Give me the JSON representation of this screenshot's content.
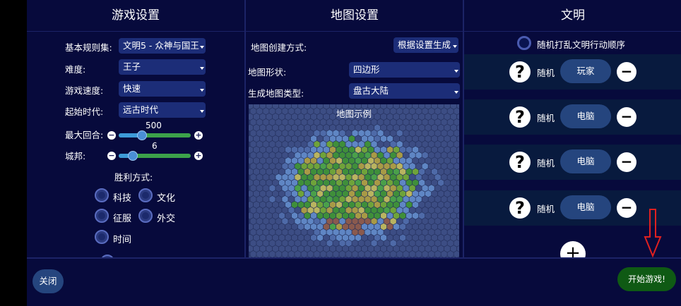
{
  "columns": {
    "game_settings_title": "游戏设置",
    "map_settings_title": "地图设置",
    "civs_title": "文明"
  },
  "game": {
    "ruleset_label": "基本规则集:",
    "ruleset_value": "文明5 - 众神与国王",
    "difficulty_label": "难度:",
    "difficulty_value": "王子",
    "speed_label": "游戏速度:",
    "speed_value": "快速",
    "era_label": "起始时代:",
    "era_value": "远古时代",
    "max_turns_label": "最大回合:",
    "max_turns_value": "500",
    "city_states_label": "城邦:",
    "city_states_value": "6",
    "victory_label": "胜利方式:",
    "victory_options": [
      "科技",
      "文化",
      "征服",
      "外交",
      "时间"
    ]
  },
  "map": {
    "creation_label": "地图创建方式:",
    "creation_value": "根据设置生成",
    "shape_label": "地图形状:",
    "shape_value": "四边形",
    "type_label": "生成地图类型:",
    "type_value": "盘古大陆",
    "preview_label": "地图示例"
  },
  "civs": {
    "shuffle_label": "随机打乱文明行动顺序",
    "rows": [
      {
        "civ": "随机",
        "player": "玩家"
      },
      {
        "civ": "随机",
        "player": "电脑"
      },
      {
        "civ": "随机",
        "player": "电脑"
      },
      {
        "civ": "随机",
        "player": "电脑"
      }
    ],
    "add_symbol": "+"
  },
  "footer": {
    "close_label": "关闭",
    "start_label": "开始游戏!"
  },
  "colors": {
    "background": "#070a3c",
    "select_bg": "#1c2d78",
    "pill_bg": "#25457e",
    "start_bg": "#0f5a14",
    "arrow": "#e02020"
  }
}
